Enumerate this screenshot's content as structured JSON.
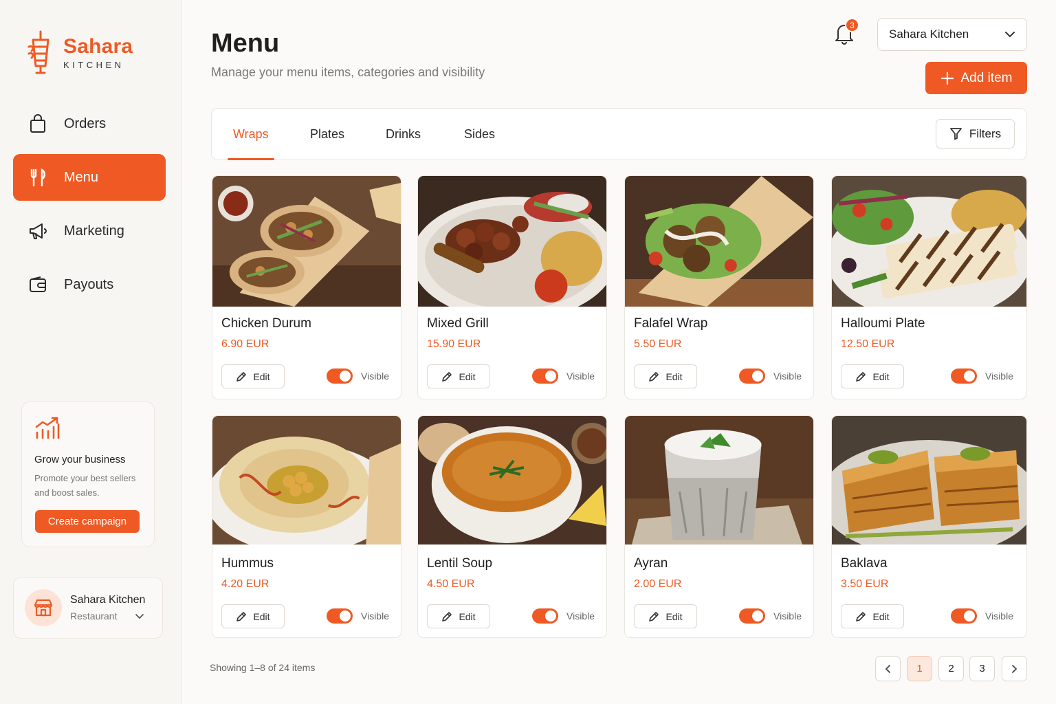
{
  "brand": {
    "name": "Sahara",
    "sub": "KITCHEN",
    "accent": "#ef5a24"
  },
  "nav": [
    {
      "label": "Orders",
      "icon": "shopping-bag-icon",
      "active": false
    },
    {
      "label": "Menu",
      "icon": "fork-knife-icon",
      "active": true
    },
    {
      "label": "Marketing",
      "icon": "megaphone-icon",
      "active": false
    },
    {
      "label": "Payouts",
      "icon": "wallet-icon",
      "active": false
    }
  ],
  "promo": {
    "title": "Grow your business",
    "text": "Promote your best sellers and boost sales.",
    "button": "Create campaign"
  },
  "account": {
    "name": "Sahara Kitchen",
    "role": "Restaurant"
  },
  "header": {
    "title": "Menu",
    "subtitle": "Manage your menu items, categories and visibility",
    "notifications": "3",
    "store": "Sahara Kitchen",
    "add_label": "Add item"
  },
  "tabs": [
    {
      "label": "Wraps",
      "active": true
    },
    {
      "label": "Plates",
      "active": false
    },
    {
      "label": "Drinks",
      "active": false
    },
    {
      "label": "Sides",
      "active": false
    }
  ],
  "filters_label": "Filters",
  "items": [
    {
      "name": "Chicken Durum",
      "price": "6.90 EUR",
      "edit": "Edit",
      "visible_label": "Visible",
      "visible": true
    },
    {
      "name": "Mixed Grill",
      "price": "15.90 EUR",
      "edit": "Edit",
      "visible_label": "Visible",
      "visible": true
    },
    {
      "name": "Falafel Wrap",
      "price": "5.50 EUR",
      "edit": "Edit",
      "visible_label": "Visible",
      "visible": true
    },
    {
      "name": "Halloumi Plate",
      "price": "12.50 EUR",
      "edit": "Edit",
      "visible_label": "Visible",
      "visible": true
    },
    {
      "name": "Hummus",
      "price": "4.20 EUR",
      "edit": "Edit",
      "visible_label": "Visible",
      "visible": true
    },
    {
      "name": "Lentil Soup",
      "price": "4.50 EUR",
      "edit": "Edit",
      "visible_label": "Visible",
      "visible": true
    },
    {
      "name": "Ayran",
      "price": "2.00 EUR",
      "edit": "Edit",
      "visible_label": "Visible",
      "visible": true
    },
    {
      "name": "Baklava",
      "price": "3.50 EUR",
      "edit": "Edit",
      "visible_label": "Visible",
      "visible": true
    }
  ],
  "pagination": {
    "summary": "Showing 1–8 of 24 items",
    "pages": [
      "1",
      "2",
      "3"
    ],
    "current": "1"
  }
}
